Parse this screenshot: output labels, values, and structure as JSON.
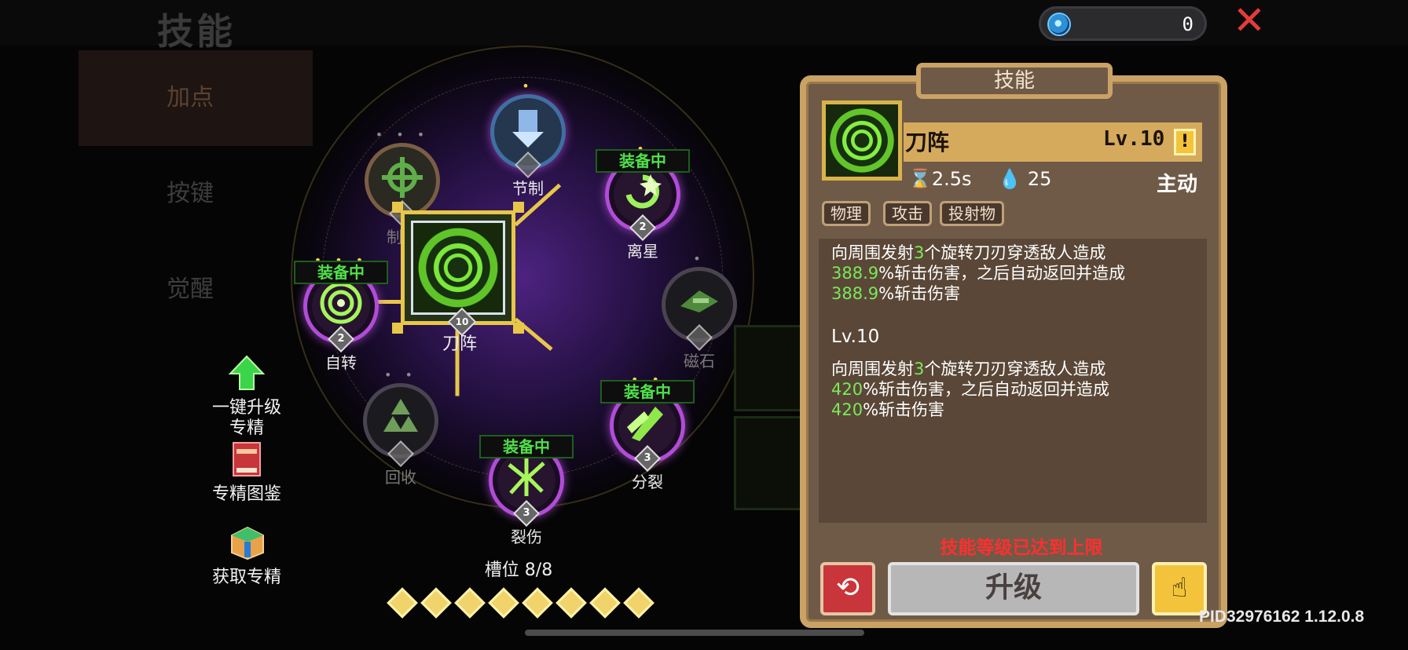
{
  "header": {
    "title": "技能",
    "currency_value": "0",
    "currency_icon": "spiral-gem-icon",
    "close_icon": "close-x-icon"
  },
  "sidebar": {
    "items": [
      {
        "label": "加点"
      },
      {
        "label": "按键"
      },
      {
        "label": "觉醒"
      }
    ]
  },
  "tools": {
    "upgrade_all": {
      "line1": "一键升级",
      "line2": "专精",
      "icon": "green-up-arrow-icon"
    },
    "codex": {
      "label": "专精图鉴",
      "icon": "red-book-icon"
    },
    "acquire": {
      "label": "获取专精",
      "icon": "gift-box-icon"
    }
  },
  "tree": {
    "equipped_label": "装备中",
    "center": {
      "name": "刀阵",
      "level": "10",
      "icon": "blade-array-icon"
    },
    "nodes": [
      {
        "name": "节制",
        "level": "",
        "icon": "down-arrow-icon",
        "dots": "•"
      },
      {
        "name": "制导",
        "level": "",
        "icon": "crosshair-icon",
        "dots": "• • •"
      },
      {
        "name": "离星",
        "level": "2",
        "icon": "orbit-star-icon",
        "dots": "•"
      },
      {
        "name": "自转",
        "level": "2",
        "icon": "spiral-icon",
        "dots": "• • •"
      },
      {
        "name": "磁石",
        "level": "",
        "icon": "magnet-blade-icon",
        "dots": "•"
      },
      {
        "name": "回收",
        "level": "",
        "icon": "recycle-icon",
        "dots": "• •"
      },
      {
        "name": "分裂",
        "level": "3",
        "icon": "split-blade-icon",
        "dots": "• •"
      },
      {
        "name": "裂伤",
        "level": "3",
        "icon": "laceration-icon",
        "dots": ""
      }
    ],
    "slot_text": "槽位 8/8",
    "slots_filled": 8
  },
  "panel": {
    "tab": "技能",
    "skill_name": "刀阵",
    "level": "Lv.10",
    "warn": "!",
    "cooldown": "2.5s",
    "cost": "25",
    "type": "主动",
    "tags": [
      "物理",
      "攻击",
      "投射物"
    ],
    "desc": {
      "l1": "向周围发射",
      "l1_n": "3",
      "l1_b": "个旋转刀刃穿透敌人造成",
      "l2_n": "388.9",
      "l2_b": "%斩击伤害，之后自动返回并造成",
      "l3_n": "388.9",
      "l3_b": "%斩击伤害"
    },
    "next_label": "Lv.10",
    "next": {
      "l1": "向周围发射",
      "l1_n": "3",
      "l1_b": "个旋转刀刃穿透敌人造成",
      "l2_n": "420",
      "l2_b": "%斩击伤害，之后自动返回并造成",
      "l3_n": "420",
      "l3_b": "%斩击伤害"
    },
    "max_text": "技能等级已达到上限",
    "upgrade_label": "升级"
  },
  "footer": {
    "pid": "PID32976162 1.12.0.8"
  }
}
